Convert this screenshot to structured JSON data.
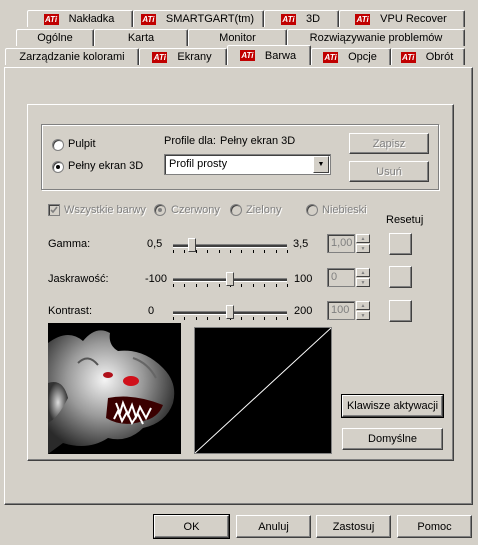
{
  "tabs_row1": [
    {
      "label": "Nakładka",
      "ati": true
    },
    {
      "label": "SMARTGART(tm)",
      "ati": true
    },
    {
      "label": "3D",
      "ati": true
    },
    {
      "label": "VPU Recover",
      "ati": true
    }
  ],
  "tabs_row2": [
    {
      "label": "Ogólne"
    },
    {
      "label": "Karta"
    },
    {
      "label": "Monitor"
    },
    {
      "label": "Rozwiązywanie problemów"
    }
  ],
  "tabs_row3": [
    {
      "label": "Zarządzanie kolorami"
    },
    {
      "label": "Ekrany",
      "ati": true
    },
    {
      "label": "Barwa",
      "ati": true,
      "active": true
    },
    {
      "label": "Opcje",
      "ati": true
    },
    {
      "label": "Obrót",
      "ati": true
    }
  ],
  "ati_logo_text": "ATi",
  "profile": {
    "radio_desktop": "Pulpit",
    "radio_fullscreen": "Pełny ekran 3D",
    "selected": "fullscreen",
    "profile_for_label": "Profile dla:",
    "profile_for_value": "Pełny ekran 3D",
    "dropdown_value": "Profil prosty",
    "save_button": "Zapisz",
    "delete_button": "Usuń"
  },
  "channels": {
    "all_label": "Wszystkie barwy",
    "all_checked": true,
    "red": "Czerwony",
    "green": "Zielony",
    "blue": "Niebieski",
    "selected": "red"
  },
  "reset_label": "Resetuj",
  "sliders": [
    {
      "label": "Gamma:",
      "min": "0,5",
      "max": "3,5",
      "value": "1,00",
      "level": 0.17
    },
    {
      "label": "Jaskrawość:",
      "min": "-100",
      "max": "100",
      "value": "0",
      "level": 0.5
    },
    {
      "label": "Kontrast:",
      "min": "0",
      "max": "200",
      "value": "100",
      "level": 0.5
    }
  ],
  "hotkeys_button": "Klawisze aktywacji",
  "defaults_button": "Domyślne",
  "footer": {
    "ok": "OK",
    "cancel": "Anuluj",
    "apply": "Zastosuj",
    "help": "Pomoc"
  },
  "colors": {
    "face": "#d4d0c8",
    "ati_red": "#c00000",
    "curve_bg": "#000000",
    "curve_line": "#ffffff"
  }
}
